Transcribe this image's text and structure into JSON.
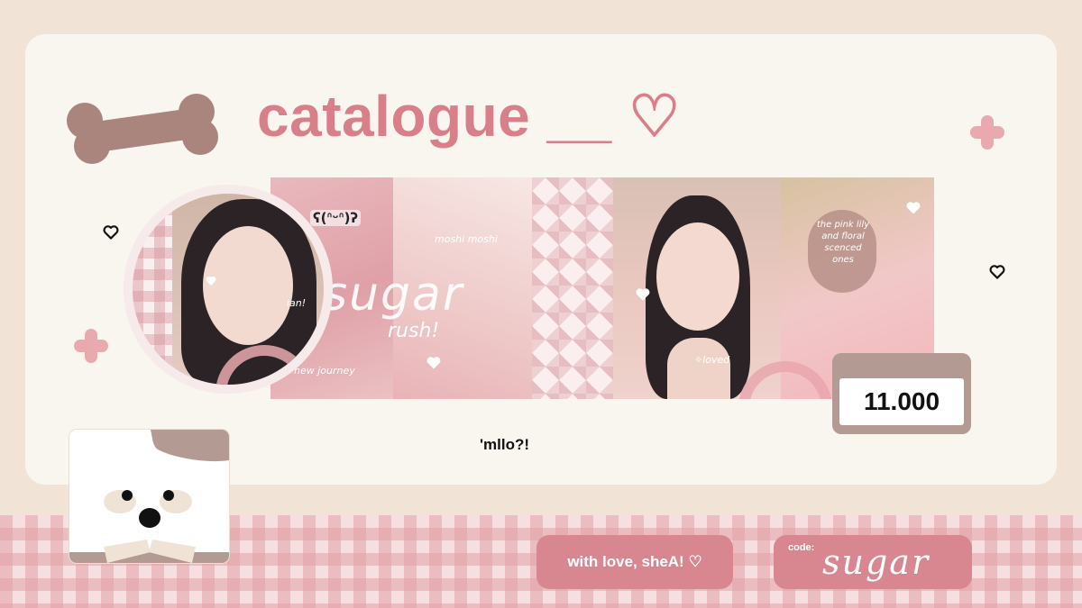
{
  "header": {
    "title": "catalogue __ ♡"
  },
  "collage": {
    "kaomoji": "ʕ(ᐢᵕᐢ)ʔ",
    "sugar": "sugar",
    "rush": "rush!",
    "moshi": "moshi moshi",
    "new_journey": "new journey",
    "ian": "ian!",
    "loved": "✧loved",
    "bubble": "the pink lily and floral scenced ones"
  },
  "price": {
    "value": "11.000"
  },
  "caption": "'mllo?!",
  "footer": {
    "love_label": "with love, sheA! ♡",
    "code_label": "code:",
    "code_value": "sugar"
  },
  "colors": {
    "accent_pink": "#d88790",
    "title_pink": "#d97f89",
    "cream": "#f9f5ef",
    "background": "#f1e4d6",
    "bone": "#a9857e",
    "price_frame": "#b39a92"
  },
  "icons": [
    "bone-icon",
    "plus-icon",
    "heart-icon",
    "dog-face-icon"
  ]
}
